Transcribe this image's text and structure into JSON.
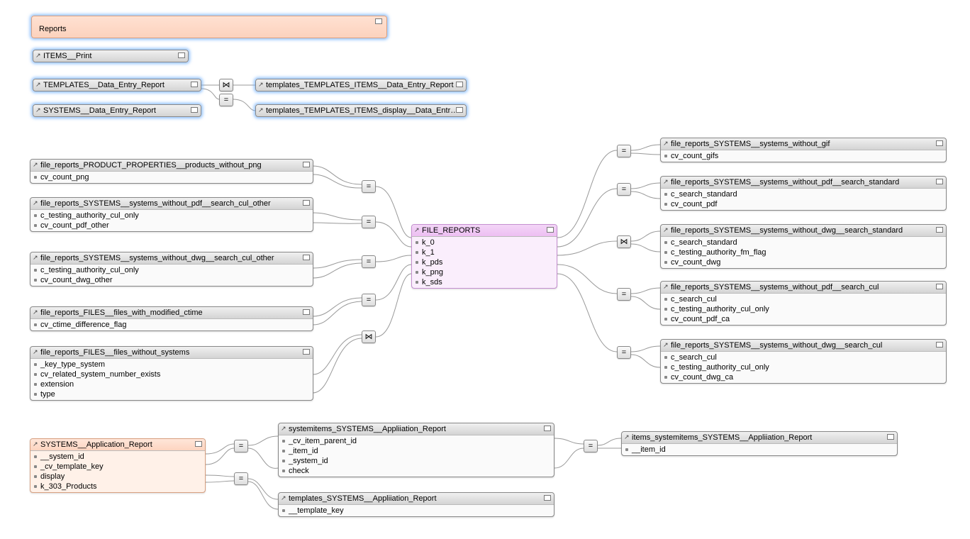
{
  "reports": {
    "label": "Reports"
  },
  "top_nodes": {
    "items_print": "ITEMS__Print",
    "templates_der": "TEMPLATES__Data_Entry_Report",
    "systems_der": "SYSTEMS__Data_Entry_Report",
    "templates_items_der": "templates_TEMPLATES_ITEMS__Data_Entry_Report",
    "templates_items_display_der": "templates_TEMPLATES_ITEMS_display__Data_Entry_R…"
  },
  "left_nodes": {
    "products_without_png": {
      "title": "file_reports_PRODUCT_PROPERTIES__products_without_png",
      "fields": [
        "cv_count_png"
      ]
    },
    "sys_without_pdf_cul": {
      "title": "file_reports_SYSTEMS__systems_without_pdf__search_cul_other",
      "fields": [
        "c_testing_authority_cul_only",
        "cv_count_pdf_other"
      ]
    },
    "sys_without_dwg_cul": {
      "title": "file_reports_SYSTEMS__systems_without_dwg__search_cul_other",
      "fields": [
        "c_testing_authority_cul_only",
        "cv_count_dwg_other"
      ]
    },
    "files_modified_ctime": {
      "title": "file_reports_FILES__files_with_modified_ctime",
      "fields": [
        "cv_ctime_difference_flag"
      ]
    },
    "files_without_systems": {
      "title": "file_reports_FILES__files_without_systems",
      "fields": [
        "_key_type_system",
        "cv_related_system_number_exists",
        "extension",
        "type"
      ]
    }
  },
  "center_node": {
    "title": "FILE_REPORTS",
    "fields": [
      "k_0",
      "k_1",
      "k_pds",
      "k_png",
      "k_sds"
    ]
  },
  "right_nodes": {
    "sys_without_gif": {
      "title": "file_reports_SYSTEMS__systems_without_gif",
      "fields": [
        "cv_count_gifs"
      ]
    },
    "sys_without_pdf_std": {
      "title": "file_reports_SYSTEMS__systems_without_pdf__search_standard",
      "fields": [
        "c_search_standard",
        "cv_count_pdf"
      ]
    },
    "sys_without_dwg_std": {
      "title": "file_reports_SYSTEMS__systems_without_dwg__search_standard",
      "fields": [
        "c_search_standard",
        "c_testing_authority_fm_flag",
        "cv_count_dwg"
      ]
    },
    "sys_without_pdf_cul_r": {
      "title": "file_reports_SYSTEMS__systems_without_pdf__search_cul",
      "fields": [
        "c_search_cul",
        "c_testing_authority_cul_only",
        "cv_count_pdf_ca"
      ]
    },
    "sys_without_dwg_cul_r": {
      "title": "file_reports_SYSTEMS__systems_without_dwg__search_cul",
      "fields": [
        "c_search_cul",
        "c_testing_authority_cul_only",
        "cv_count_dwg_ca"
      ]
    }
  },
  "bottom_nodes": {
    "sys_app_report": {
      "title": "SYSTEMS__Application_Report",
      "fields": [
        "__system_id",
        "_cv_template_key",
        "display",
        "k_303_Products"
      ]
    },
    "systemitems_app": {
      "title": "systemitems_SYSTEMS__Appliiation_Report",
      "fields": [
        "_cv_item_parent_id",
        "_item_id",
        "_system_id",
        "check"
      ]
    },
    "items_systemitems_app": {
      "title": "items_systemitems_SYSTEMS__Appliiation_Report",
      "fields": [
        "__item_id"
      ]
    },
    "templates_sys_app": {
      "title": "templates_SYSTEMS__Appliiation_Report",
      "fields": [
        "__template_key"
      ]
    }
  },
  "ops": {
    "join": "⋈",
    "equal": "="
  }
}
